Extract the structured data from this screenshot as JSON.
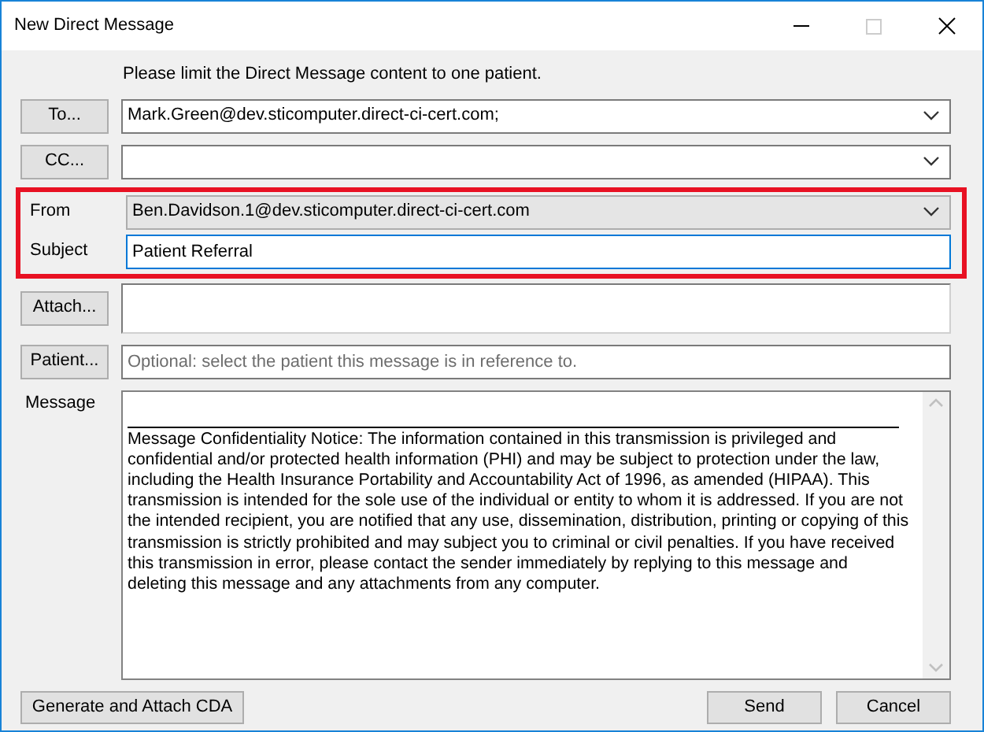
{
  "window": {
    "title": "New Direct Message"
  },
  "notice": "Please limit the Direct Message content to one patient.",
  "fields": [
    {
      "kind": "button-combo",
      "button": "To...",
      "value": "Mark.Green@dev.sticomputer.direct-ci-cert.com;",
      "highlighted": false,
      "focused": false
    },
    {
      "kind": "button-combo",
      "button": "CC...",
      "highlighted": false,
      "focused": false
    },
    {
      "kind": "label-combo",
      "label": "From",
      "value": "Ben.Davidson.1@dev.sticomputer.direct-ci-cert.com",
      "highlighted": true,
      "focused": false
    },
    {
      "kind": "label-text",
      "label": "Subject",
      "value": "Patient Referral",
      "highlighted": true,
      "focused": true
    },
    {
      "kind": "button-area",
      "button": "Attach...",
      "highlighted": false,
      "focused": false
    },
    {
      "kind": "button-text",
      "button": "Patient...",
      "placeholder": "Optional: select the patient this message is in reference to.",
      "highlighted": false,
      "focused": false
    }
  ],
  "message": {
    "label": "Message",
    "text": "Message Confidentiality Notice: The information contained in this transmission is privileged and confidential and/or protected health information (PHI) and may be subject to protection under the law, including the Health Insurance Portability and Accountability Act of 1996, as amended (HIPAA). This transmission is intended for the sole use of the individual or entity to whom it is addressed. If you are not the intended recipient, you are notified that any use, dissemination, distribution, printing or copying of this transmission is strictly prohibited and may subject you to criminal or civil penalties. If you have received this transmission in error, please contact the sender immediately by replying to this message and deleting this message and any attachments from any computer."
  },
  "footer": {
    "left_button": "Generate and Attach CDA",
    "right_buttons": [
      "Send",
      "Cancel"
    ]
  }
}
